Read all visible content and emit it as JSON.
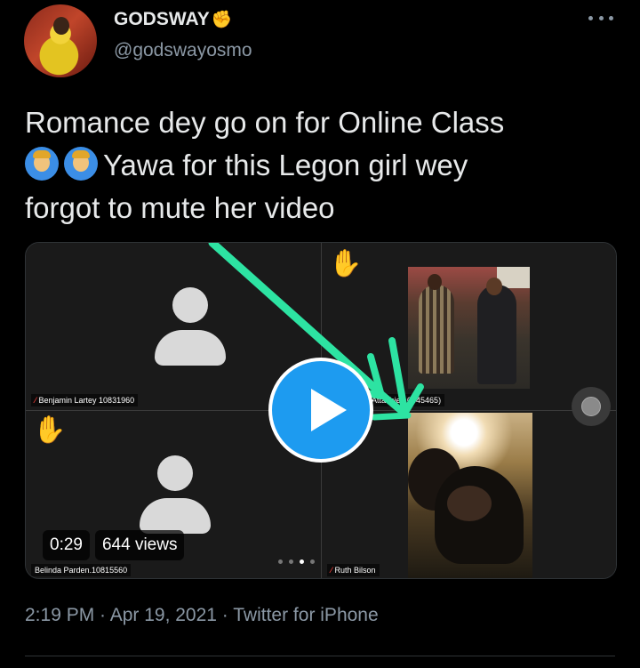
{
  "user": {
    "display_name": "GODSWAY",
    "badge_emoji": "✊",
    "handle": "@godswayosmo"
  },
  "tweet": {
    "line1": "Romance dey go on for Online Class",
    "line2": "Yawa for this Legon girl wey",
    "line3": "forgot to mute her video",
    "emoji_count": 2
  },
  "media": {
    "participants": [
      {
        "name": "Benjamin Lartey 10831960"
      },
      {
        "name": "Attachie 10845465)"
      },
      {
        "name": "Belinda Parden.10815560"
      },
      {
        "name": "Ruth Bilson"
      }
    ],
    "duration": "0:29",
    "views": "644 views",
    "page_dots": 4,
    "active_dot": 2
  },
  "footer": {
    "timestamp": "2:19 PM · Apr 19, 2021 · Twitter for iPhone"
  },
  "colors": {
    "accent": "#1d9bf0",
    "arrow": "#2de3a2",
    "muted": "#8b98a5",
    "text": "#e7e9ea"
  }
}
